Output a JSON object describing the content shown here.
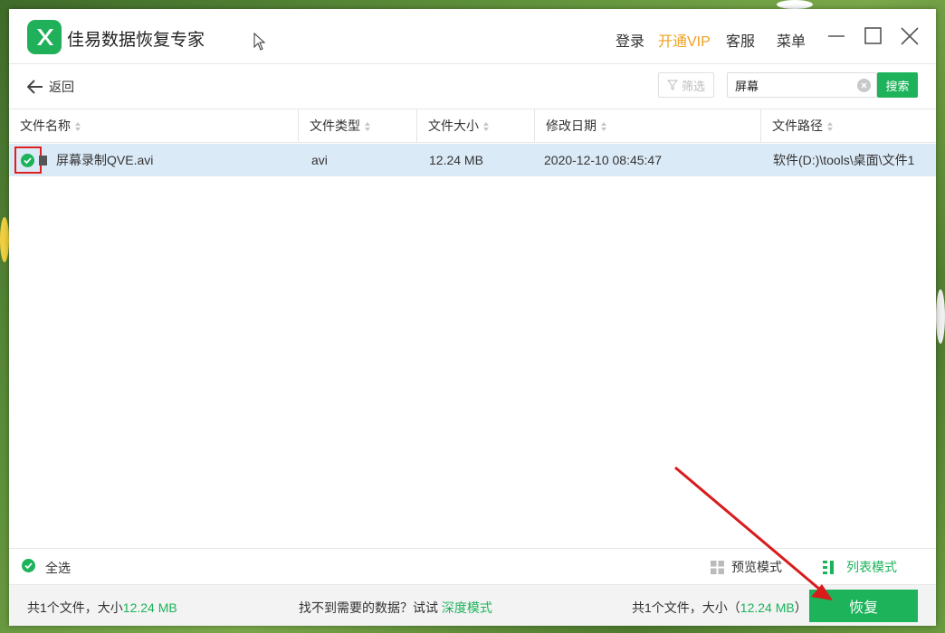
{
  "app": {
    "title": "佳易数据恢复专家"
  },
  "topbar": {
    "login": "登录",
    "vip": "开通VIP",
    "service": "客服",
    "menu": "菜单"
  },
  "toolbar": {
    "back": "返回",
    "filter": "筛选",
    "search_value": "屏幕",
    "search_button": "搜索"
  },
  "table": {
    "headers": [
      "文件名称",
      "文件类型",
      "文件大小",
      "修改日期",
      "文件路径"
    ],
    "rows": [
      {
        "name": "屏幕录制QVE.avi",
        "type": "avi",
        "size": "12.24 MB",
        "date": "2020-12-10 08:45:47",
        "path": "软件(D:)\\tools\\桌面\\文件1"
      }
    ]
  },
  "footer": {
    "select_all": "全选",
    "preview_mode": "预览模式",
    "list_mode": "列表模式",
    "total_prefix": "共1个文件，大小",
    "total_size": "12.24 MB",
    "hint": "找不到需要的数据？试试",
    "deep_mode": "深度模式",
    "selected_prefix": "共1个文件，大小（",
    "selected_size": "12.24 MB",
    "selected_suffix": "）",
    "recover": "恢复"
  },
  "colors": {
    "accent": "#1cb35a",
    "vip": "#f0a020",
    "selected_row": "#dbeaf7",
    "highlight_box": "#e02020",
    "annotation_arrow": "#d81c1c"
  }
}
